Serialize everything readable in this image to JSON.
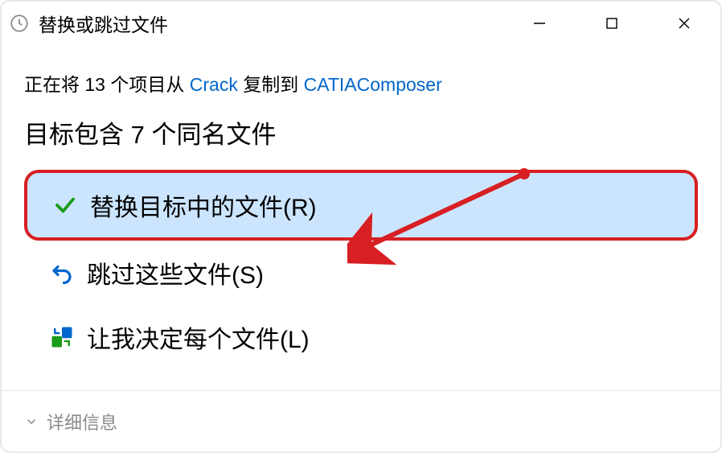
{
  "titlebar": {
    "title": "替换或跳过文件"
  },
  "progress": {
    "prefix": "正在将 13 个项目从 ",
    "source": "Crack",
    "middle": " 复制到 ",
    "dest": "CATIAComposer"
  },
  "subhead": "目标包含 7 个同名文件",
  "options": {
    "replace": "替换目标中的文件(R)",
    "skip": "跳过这些文件(S)",
    "decide": "让我决定每个文件(L)"
  },
  "footer": {
    "details": "详细信息"
  }
}
